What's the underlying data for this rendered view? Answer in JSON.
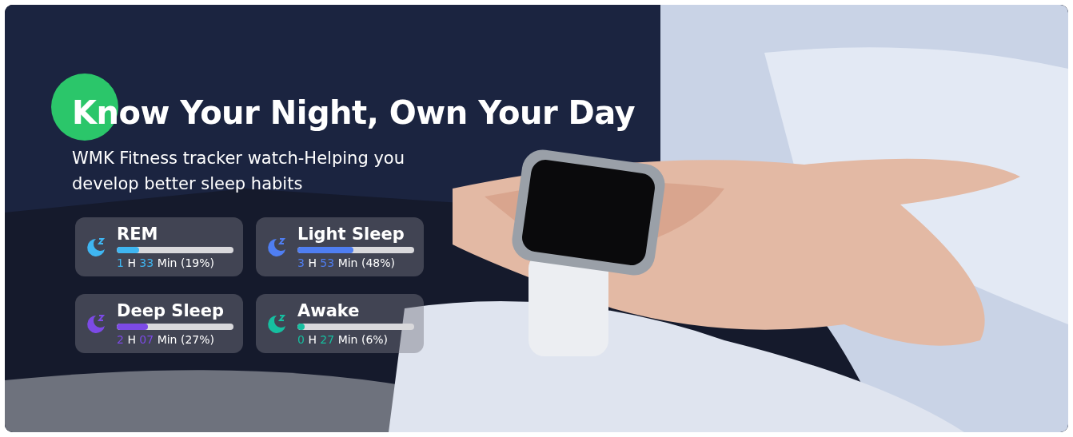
{
  "banner": {
    "title": "Know Your Night, Own Your Day",
    "subtitle": "WMK Fitness tracker watch-Helping you develop better sleep habits"
  },
  "stages": [
    {
      "name": "REM",
      "color": "#3fb6f2",
      "level": 0.19,
      "hours": "1",
      "hours_unit": "H",
      "minutes": "33",
      "rest": "Min (19%)"
    },
    {
      "name": "Light Sleep",
      "color": "#4f7ef2",
      "level": 0.48,
      "hours": "3",
      "hours_unit": "H",
      "minutes": "53",
      "rest": "Min (48%)"
    },
    {
      "name": "Deep Sleep",
      "color": "#7c4ae6",
      "level": 0.27,
      "hours": "2",
      "hours_unit": "H",
      "minutes": "07",
      "rest": "Min (27%)"
    },
    {
      "name": "Awake",
      "color": "#16bfa0",
      "level": 0.06,
      "hours": "0",
      "hours_unit": "H",
      "minutes": "27",
      "rest": "Min (6%)"
    }
  ]
}
